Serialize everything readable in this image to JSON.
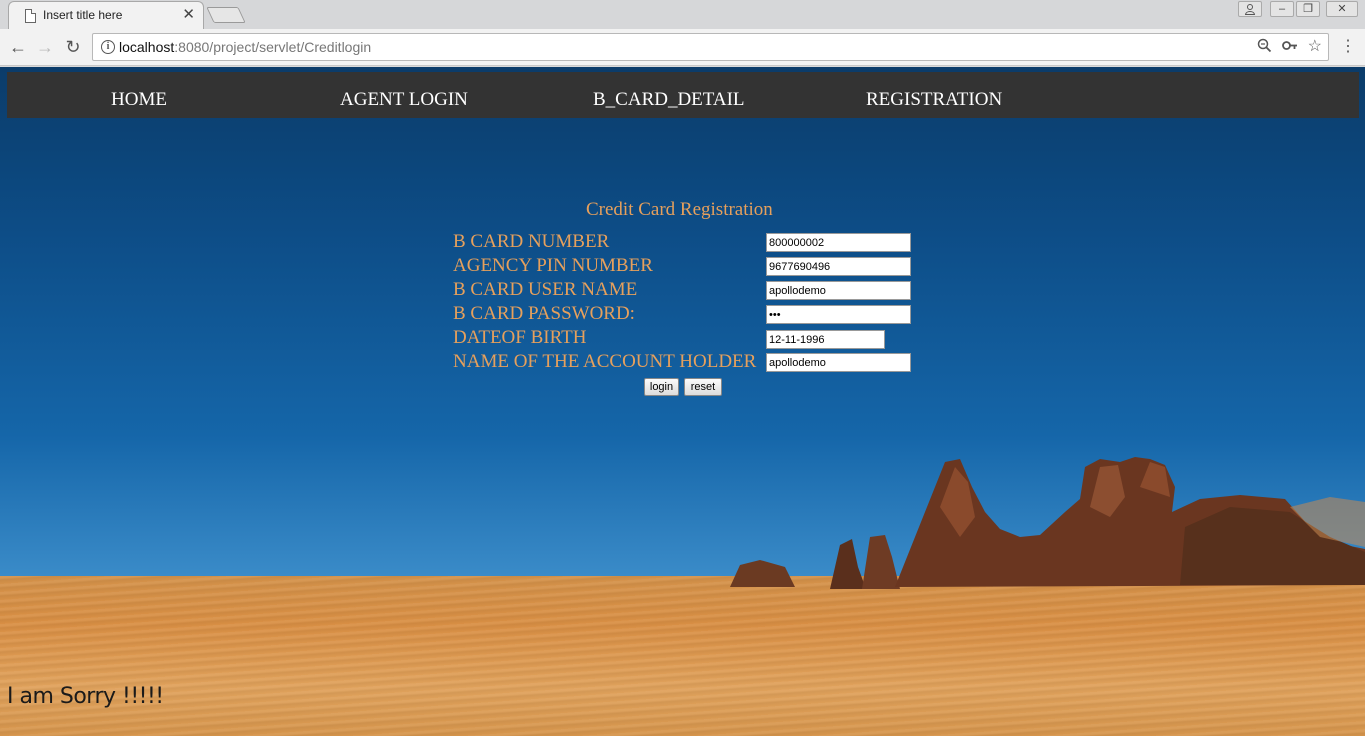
{
  "browser": {
    "tab_title": "Insert title here",
    "url_host": "localhost",
    "url_path": ":8080/project/servlet/Creditlogin"
  },
  "icons": {
    "back": "back-arrow-icon",
    "forward": "forward-arrow-icon",
    "reload": "reload-icon",
    "info": "info-icon",
    "zoom": "zoom-icon",
    "key": "key-icon",
    "star": "star-icon",
    "menu": "menu-icon"
  },
  "nav": {
    "items": [
      "HOME",
      "AGENT LOGIN",
      "B_CARD_DETAIL",
      "REGISTRATION"
    ]
  },
  "form": {
    "title": "Credit Card Registration",
    "fields": [
      {
        "label": "B CARD NUMBER",
        "value": "800000002"
      },
      {
        "label": "AGENCY PIN NUMBER",
        "value": "9677690496"
      },
      {
        "label": "B CARD USER NAME",
        "value": "apollodemo"
      },
      {
        "label": "B CARD PASSWORD:",
        "value": "•••"
      },
      {
        "label": "DATEOF BIRTH",
        "value": "12-11-1996"
      },
      {
        "label": "NAME OF THE ACCOUNT HOLDER",
        "value": "apollodemo"
      }
    ],
    "login_label": "login",
    "reset_label": "reset"
  },
  "message": "I am Sorry !!!!!",
  "colors": {
    "navbar": "#333333",
    "label": "#e6a05c",
    "sky_top": "#0b3c6a",
    "sand": "#d98f44"
  }
}
